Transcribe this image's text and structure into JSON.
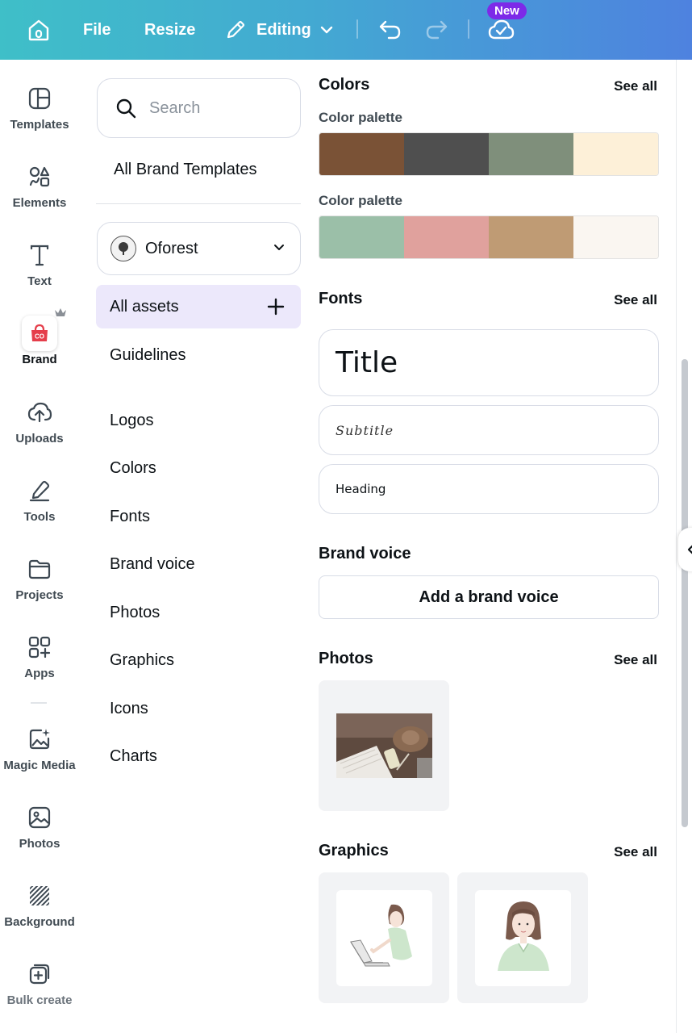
{
  "topbar": {
    "file": "File",
    "resize": "Resize",
    "editing": "Editing",
    "new_badge": "New"
  },
  "rail": {
    "items": [
      {
        "label": "Templates",
        "icon": "templates-icon"
      },
      {
        "label": "Elements",
        "icon": "elements-icon"
      },
      {
        "label": "Text",
        "icon": "text-icon"
      },
      {
        "label": "Brand",
        "icon": "brand-icon"
      },
      {
        "label": "Uploads",
        "icon": "upload-cloud-icon"
      },
      {
        "label": "Tools",
        "icon": "pen-icon"
      },
      {
        "label": "Projects",
        "icon": "folder-icon"
      },
      {
        "label": "Apps",
        "icon": "apps-icon"
      },
      {
        "label": "Magic Media",
        "icon": "magic-image-icon"
      },
      {
        "label": "Photos",
        "icon": "photo-icon"
      },
      {
        "label": "Background",
        "icon": "background-hatch-icon"
      },
      {
        "label": "Bulk create",
        "icon": "bulk-create-icon"
      }
    ]
  },
  "middle": {
    "search_placeholder": "Search",
    "all_brand_templates": "All Brand Templates",
    "brand_name": "Oforest",
    "all_assets": "All assets",
    "guidelines": "Guidelines",
    "links": [
      "Logos",
      "Colors",
      "Fonts",
      "Brand voice",
      "Photos",
      "Graphics",
      "Icons",
      "Charts"
    ]
  },
  "right": {
    "colors_title": "Colors",
    "see_all": "See all",
    "palette_label": "Color palette",
    "palettes": [
      [
        "#7a5236",
        "#4f4f4f",
        "#7f8f7b",
        "#fdf0d8"
      ],
      [
        "#9bbfa8",
        "#e0a19d",
        "#bf9b74",
        "#faf6f1"
      ]
    ],
    "fonts_title": "Fonts",
    "font_title": "Title",
    "font_subtitle": "Subtitle",
    "font_heading": "Heading",
    "brand_voice_title": "Brand voice",
    "add_brand_voice": "Add a brand voice",
    "photos_title": "Photos",
    "graphics_title": "Graphics"
  }
}
